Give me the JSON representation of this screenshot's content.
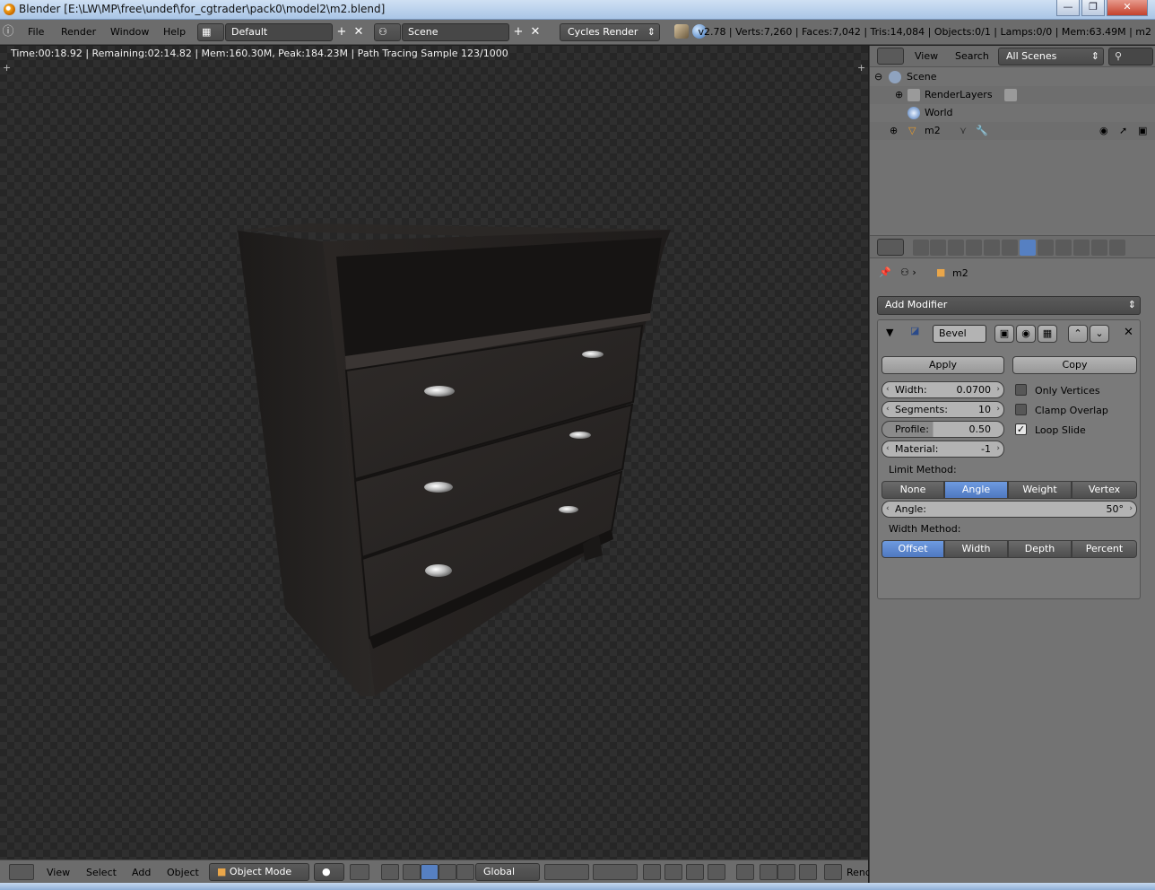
{
  "window": {
    "title": "Blender [E:\\LW\\MP\\free\\undef\\for_cgtrader\\pack0\\model2\\m2.blend]",
    "minimize": "—",
    "maximize": "❐",
    "close": "✕"
  },
  "info_header": {
    "menus": [
      "File",
      "Render",
      "Window",
      "Help"
    ],
    "layout": "Default",
    "scene": "Scene",
    "engine": "Cycles Render",
    "stats": "v2.78 | Verts:7,260 | Faces:7,042 | Tris:14,084 | Objects:0/1 | Lamps:0/0 | Mem:63.49M | m2"
  },
  "viewport": {
    "render_status": "Time:00:18.92 | Remaining:02:14.82 | Mem:160.30M, Peak:184.23M | Path Tracing Sample 123/1000"
  },
  "viewport_header": {
    "menus": [
      "View",
      "Select",
      "Add",
      "Object"
    ],
    "mode": "Object Mode",
    "orientation": "Global",
    "render_btn": "Rend"
  },
  "outliner": {
    "menus": [
      "View",
      "Search"
    ],
    "filter": "All Scenes",
    "rows": [
      "Scene",
      "RenderLayers",
      "World",
      "m2"
    ]
  },
  "properties": {
    "object_name": "m2",
    "add_modifier": "Add Modifier",
    "modifier_name": "Bevel",
    "apply": "Apply",
    "copy": "Copy",
    "width": {
      "label": "Width:",
      "value": "0.0700"
    },
    "segments": {
      "label": "Segments:",
      "value": "10"
    },
    "profile": {
      "label": "Profile:",
      "value": "0.50"
    },
    "material": {
      "label": "Material:",
      "value": "-1"
    },
    "only_vertices": "Only Vertices",
    "clamp_overlap": "Clamp Overlap",
    "loop_slide": "Loop Slide",
    "limit_method_label": "Limit Method:",
    "limit_methods": [
      "None",
      "Angle",
      "Weight",
      "Vertex Group"
    ],
    "angle": {
      "label": "Angle:",
      "value": "50°"
    },
    "width_method_label": "Width Method:",
    "width_methods": [
      "Offset",
      "Width",
      "Depth",
      "Percent"
    ]
  }
}
